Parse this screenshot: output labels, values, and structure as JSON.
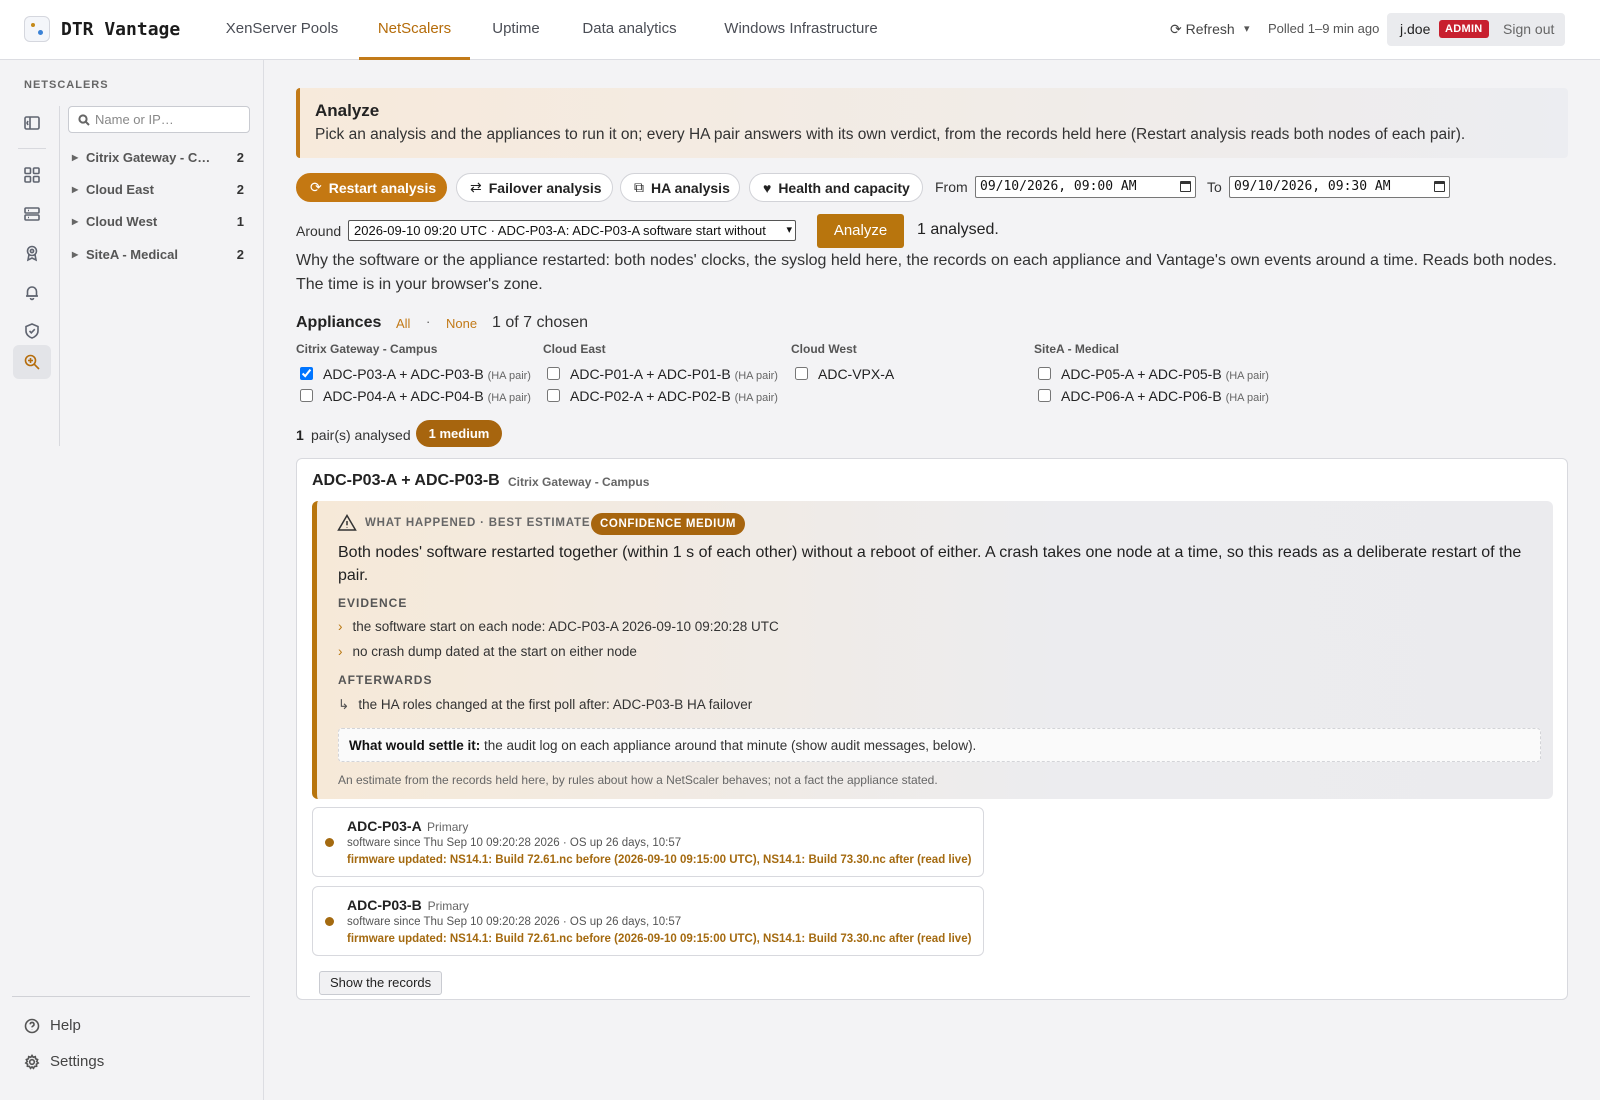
{
  "app": {
    "title": "DTR Vantage"
  },
  "nav": {
    "tabs": [
      {
        "label": "XenServer Pools",
        "active": false
      },
      {
        "label": "NetScalers",
        "active": true
      },
      {
        "label": "Uptime",
        "active": false
      },
      {
        "label": "Data analytics",
        "active": false
      },
      {
        "label": "Windows Infrastructure",
        "active": false
      }
    ]
  },
  "header": {
    "refresh_label": "⟳ Refresh",
    "refresh_caret": "▾",
    "polled": "Polled 1–9 min ago",
    "user": "j.doe",
    "role": "ADMIN",
    "signout": "Sign out"
  },
  "sidebar": {
    "title": "NETSCALERS",
    "search_placeholder": "Name or IP…",
    "groups": [
      {
        "name": "Citrix Gateway - Campus",
        "count": "2"
      },
      {
        "name": "Cloud East",
        "count": "2"
      },
      {
        "name": "Cloud West",
        "count": "1"
      },
      {
        "name": "SiteA - Medical",
        "count": "2"
      }
    ],
    "rail_icons": [
      "collapse-icon",
      "dashboard-icon",
      "server-icon",
      "certificate-icon",
      "bell-icon",
      "shield-icon",
      "analyze-icon"
    ],
    "help": "Help",
    "settings": "Settings"
  },
  "banner": {
    "title": "Analyze",
    "text": "Pick an analysis and the appliances to run it on; every HA pair answers with its own verdict, from the records held here (Restart analysis reads both nodes of each pair)."
  },
  "analyses": [
    {
      "icon": "⟳",
      "label": "Restart analysis",
      "active": true
    },
    {
      "icon": "⇄",
      "label": "Failover analysis",
      "active": false
    },
    {
      "icon": "⧉",
      "label": "HA analysis",
      "active": false
    },
    {
      "icon": "♥",
      "label": "Health and capacity",
      "active": false
    }
  ],
  "range": {
    "from_label": "From",
    "from_value": "09/10/2026, 09:00 AM",
    "to_label": "To",
    "to_value": "09/10/2026, 09:30 AM"
  },
  "around": {
    "label": "Around",
    "value": "2026-09-10 09:20 UTC · ADC-P03-A: ADC-P03-A software start without",
    "analyze_label": "Analyze",
    "result": "1 analysed."
  },
  "description": "Why the software or the appliance restarted: both nodes' clocks, the syslog held here, the records on each appliance and Vantage's own events around a time. Reads both nodes. The time is in your browser's zone.",
  "appliances": {
    "title": "Appliances",
    "all": "All",
    "sep": "·",
    "none": "None",
    "chosen": "1 of 7 chosen",
    "ha_suffix": "(HA pair)",
    "columns": [
      {
        "group": "Citrix Gateway - Campus",
        "items": [
          {
            "name": "ADC-P03-A + ADC-P03-B",
            "ha": true,
            "checked": true
          },
          {
            "name": "ADC-P04-A + ADC-P04-B",
            "ha": true,
            "checked": false
          }
        ]
      },
      {
        "group": "Cloud East",
        "items": [
          {
            "name": "ADC-P01-A + ADC-P01-B",
            "ha": true,
            "checked": false
          },
          {
            "name": "ADC-P02-A + ADC-P02-B",
            "ha": true,
            "checked": false
          }
        ]
      },
      {
        "group": "Cloud West",
        "items": [
          {
            "name": "ADC-VPX-A",
            "ha": false,
            "checked": false
          }
        ]
      },
      {
        "group": "SiteA - Medical",
        "items": [
          {
            "name": "ADC-P05-A + ADC-P05-B",
            "ha": true,
            "checked": false
          },
          {
            "name": "ADC-P06-A + ADC-P06-B",
            "ha": true,
            "checked": false
          }
        ]
      }
    ]
  },
  "summary": {
    "count": "1",
    "label": "pair(s) analysed",
    "badge": "1 medium"
  },
  "result": {
    "pair": "ADC-P03-A + ADC-P03-B",
    "group": "Citrix Gateway - Campus",
    "kicker": "WHAT HAPPENED · BEST ESTIMATE",
    "confidence": "CONFIDENCE MEDIUM",
    "statement": "Both nodes' software restarted together (within 1 s of each other) without a reboot of either. A crash takes one node at a time, so this reads as a deliberate restart of the pair.",
    "evidence_title": "EVIDENCE",
    "evidence": [
      "the software start on each node: ADC-P03-A 2026-09-10 09:20:28 UTC",
      "no crash dump dated at the start on either node"
    ],
    "afterwards_title": "AFTERWARDS",
    "afterwards": [
      "the HA roles changed at the first poll after: ADC-P03-B HA failover"
    ],
    "settle_label": "What would settle it:",
    "settle_text": " the audit log on each appliance around that minute (show audit messages, below).",
    "note": "An estimate from the records held here, by rules about how a NetScaler behaves; not a fact the appliance stated.",
    "nodes": [
      {
        "name": "ADC-P03-A",
        "role": "Primary",
        "since": "software since Thu Sep 10 09:20:28 2026 · OS up 26 days, 10:57",
        "firmware": "firmware updated: NS14.1: Build 72.61.nc before (2026-09-10 09:15:00 UTC), NS14.1: Build 73.30.nc after (read live)"
      },
      {
        "name": "ADC-P03-B",
        "role": "Primary",
        "since": "software since Thu Sep 10 09:20:28 2026 · OS up 26 days, 10:57",
        "firmware": "firmware updated: NS14.1: Build 72.61.nc before (2026-09-10 09:15:00 UTC), NS14.1: Build 73.30.nc after (read live)"
      }
    ],
    "show_records": "Show the records"
  }
}
